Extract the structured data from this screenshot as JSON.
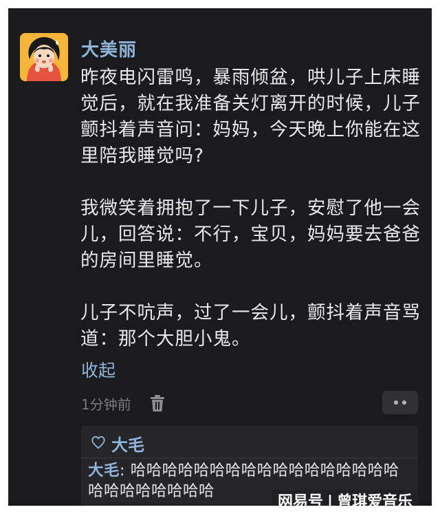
{
  "post": {
    "username": "大美丽",
    "paragraphs": [
      "昨夜电闪雷鸣，暴雨倾盆，哄儿子上床睡觉后，就在我准备关灯离开的时候，儿子颤抖着声音问：妈妈，今天晚上你能在这里陪我睡觉吗?",
      "我微笑着拥抱了一下儿子，安慰了他一会儿，回答说：不行，宝贝，妈妈要去爸爸的房间里睡觉。",
      "儿子不吭声，过了一会儿，颤抖着声音骂道：那个大胆小鬼。"
    ],
    "collapse_label": "收起",
    "timestamp": "1分钟前",
    "icons": {
      "delete": "trash-icon",
      "more": "more-dots-icon"
    }
  },
  "comments": {
    "likes_icon": "heart-outline-icon",
    "likes_name": "大毛",
    "items": [
      {
        "author": "大毛",
        "separator": ": ",
        "text": "哈哈哈哈哈哈哈哈哈哈哈哈哈哈哈哈哈哈哈哈哈哈哈哈哈"
      }
    ]
  },
  "watermark": {
    "brand": "网易号",
    "separator": "|",
    "account": "曾琪爱音乐"
  },
  "colors": {
    "background": "#1b1b1d",
    "link_blue": "#8eb4d9",
    "text": "#e9e9ea",
    "muted": "#7b7b7f",
    "comment_bg": "#26262a"
  }
}
